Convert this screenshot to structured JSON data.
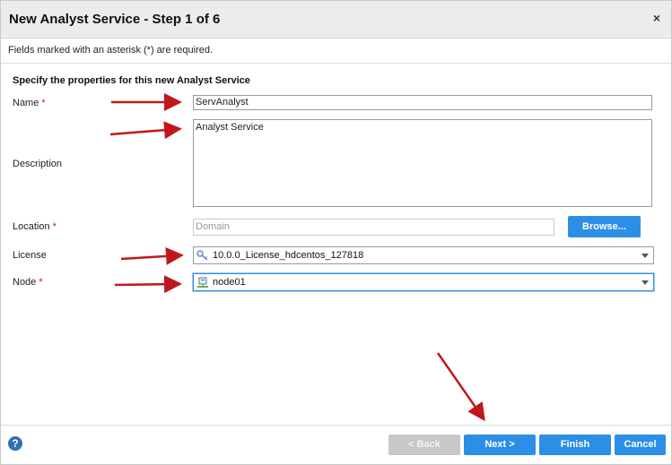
{
  "dialog": {
    "title": "New Analyst Service - Step 1 of 6",
    "close_glyph": "×",
    "required_note": "Fields marked with an asterisk (*) are required.",
    "section_title": "Specify the properties for this new Analyst Service"
  },
  "form": {
    "name": {
      "label": "Name",
      "required": "*",
      "value": "ServAnalyst"
    },
    "description": {
      "label": "Description",
      "value": "Analyst Service"
    },
    "location": {
      "label": "Location",
      "required": "*",
      "placeholder": "Domain"
    },
    "browse_label": "Browse...",
    "license": {
      "label": "License",
      "value": "10.0.0_License_hdcentos_127818",
      "icon": "key-icon"
    },
    "node": {
      "label": "Node",
      "required": "*",
      "value": "node01",
      "icon": "server-node-icon"
    }
  },
  "footer": {
    "help_glyph": "?",
    "back_label": "< Back",
    "next_label": "Next >",
    "finish_label": "Finish",
    "cancel_label": "Cancel"
  },
  "colors": {
    "accent": "#2d8ee6",
    "required": "#c21a1a",
    "annotation_arrow": "#c0171c",
    "disabled_button": "#c8c8c8"
  }
}
